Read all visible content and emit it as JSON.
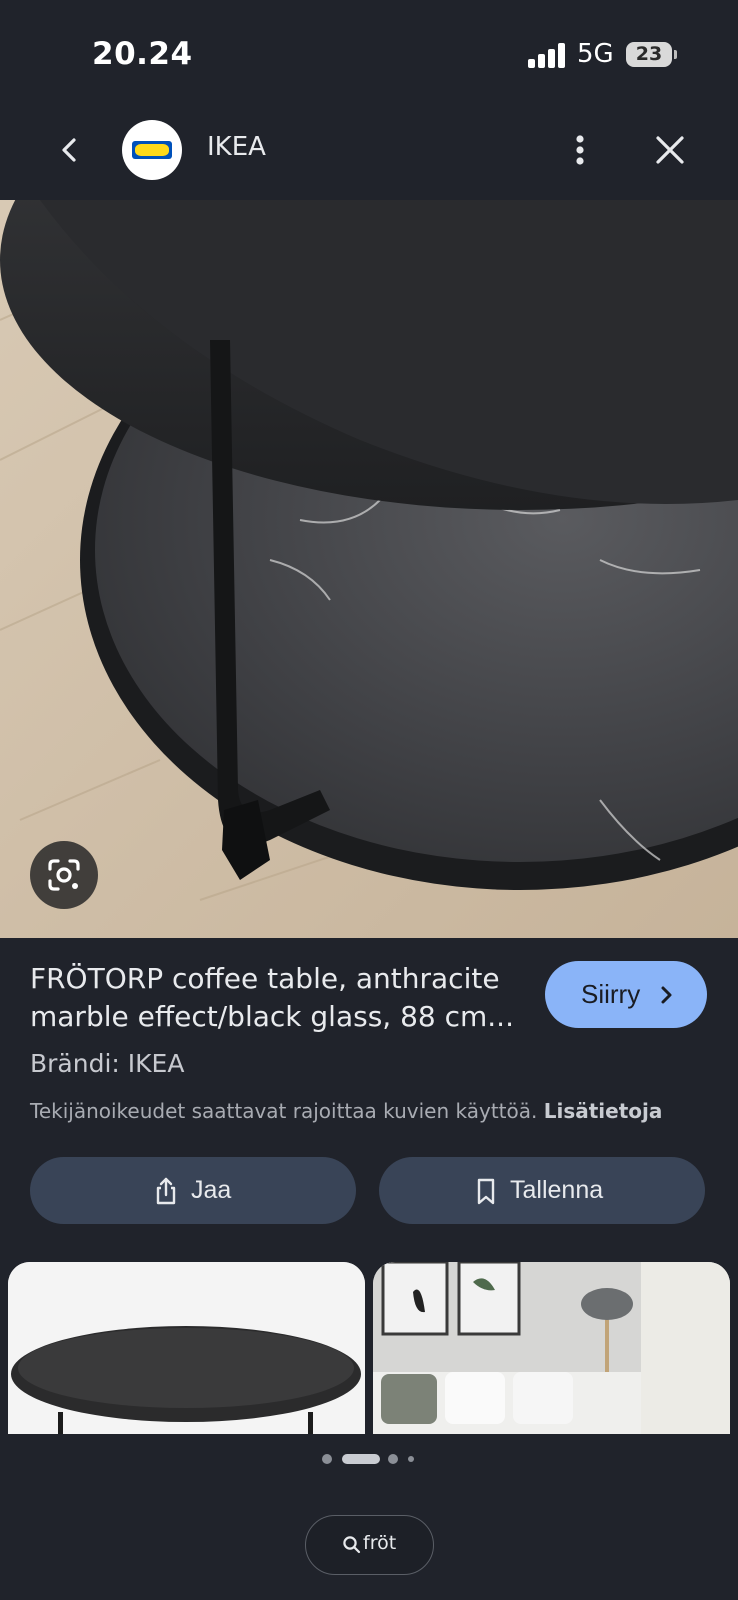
{
  "status_bar": {
    "time": "20.24",
    "network": "5G",
    "battery": "23"
  },
  "header": {
    "brand": "IKEA",
    "logo_text": "IKEA"
  },
  "product": {
    "title_line1": "FRÖTORP coffee table, anthracite",
    "title_line2": "marble effect/black glass, 88 cm...",
    "go_label": "Siirry",
    "brand_line": "Brändi: IKEA",
    "copyright": "Tekijänoikeudet saattavat rajoittaa kuvien käyttöä.",
    "more_info": "Lisätietoja"
  },
  "actions": {
    "share_label": "Jaa",
    "save_label": "Tallenna"
  },
  "pager": {
    "active_index": 1,
    "count": 4
  },
  "search": {
    "query": "fröt"
  },
  "colors": {
    "background": "#20232b",
    "accent": "#8ab4f8",
    "pill": "#394457"
  },
  "icons": {
    "back": "chevron-left-icon",
    "more": "more-vert-icon",
    "close": "close-icon",
    "lens": "google-lens-icon",
    "share": "share-icon",
    "save": "bookmark-icon",
    "search": "search-icon"
  }
}
